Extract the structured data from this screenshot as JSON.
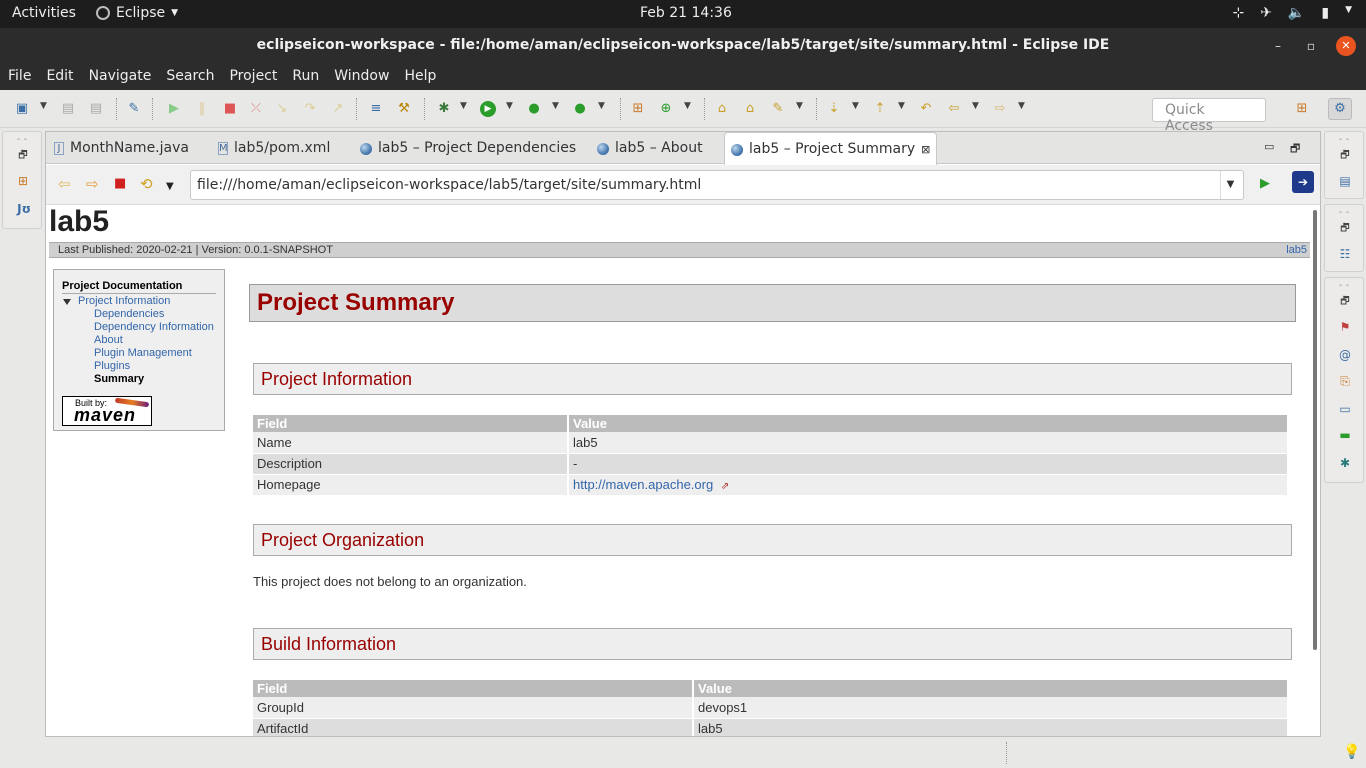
{
  "topbar": {
    "activities": "Activities",
    "app": "Eclipse",
    "clock": "Feb 21  14:36"
  },
  "window": {
    "title": "eclipseicon-workspace - file:/home/aman/eclipseicon-workspace/lab5/target/site/summary.html - Eclipse IDE"
  },
  "menu": [
    "File",
    "Edit",
    "Navigate",
    "Search",
    "Project",
    "Run",
    "Window",
    "Help"
  ],
  "toolbar": {
    "quick_access": "Quick Access"
  },
  "tabs": [
    {
      "label": "MonthName.java"
    },
    {
      "label": "lab5/pom.xml"
    },
    {
      "label": "lab5 – Project Dependencies"
    },
    {
      "label": "lab5 – About"
    },
    {
      "label": "lab5 – Project Summary"
    }
  ],
  "browser": {
    "url": "file:///home/aman/eclipseicon-workspace/lab5/target/site/summary.html"
  },
  "site": {
    "title": "lab5",
    "published": "Last Published: 2020-02-21  | Version: 0.0.1-SNAPSHOT",
    "breadcrumb_right": "lab5",
    "nav": {
      "heading": "Project Documentation",
      "section": "Project Information",
      "items": [
        "Dependencies",
        "Dependency Information",
        "About",
        "Plugin Management",
        "Plugins",
        "Summary"
      ]
    },
    "badge": {
      "built_by": "Built by:",
      "maven": "maven"
    },
    "h2": "Project Summary",
    "info": {
      "heading": "Project Information",
      "cols": [
        "Field",
        "Value"
      ],
      "rows": [
        [
          "Name",
          "lab5"
        ],
        [
          "Description",
          "-"
        ],
        [
          "Homepage",
          "http://maven.apache.org"
        ]
      ]
    },
    "org": {
      "heading": "Project Organization",
      "text": "This project does not belong to an organization."
    },
    "build": {
      "heading": "Build Information",
      "cols": [
        "Field",
        "Value"
      ],
      "rows": [
        [
          "GroupId",
          "devops1"
        ],
        [
          "ArtifactId",
          "lab5"
        ]
      ]
    }
  }
}
